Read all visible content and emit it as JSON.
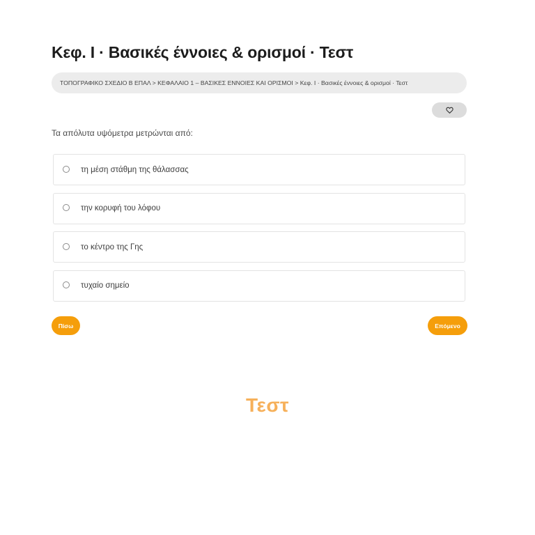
{
  "page": {
    "title": "Κεφ. Ι · Βασικές έννοιες & ορισμοί · Τεστ"
  },
  "breadcrumb": {
    "text": "ΤΟΠΟΓΡΑΦΙΚΟ ΣΧΕΔΙΟ Β ΕΠΑΛ > ΚΕΦΑΛΑΙΟ 1 – ΒΑΣΙΚΕΣ ΕΝΝΟΙΕΣ ΚΑΙ ΟΡΙΣΜΟΙ > Κεφ. Ι · Βασικές έννοιες & ορισμοί · Τεστ"
  },
  "favorite": {
    "icon": "heart-icon"
  },
  "quiz": {
    "question": "Τα απόλυτα υψόμετρα μετρώνται από:",
    "options": [
      {
        "label": "τη μέση στάθμη της θάλασσας",
        "selected": false
      },
      {
        "label": "την κορυφή του λόφου",
        "selected": false
      },
      {
        "label": "το κέντρο της Γης",
        "selected": false
      },
      {
        "label": "τυχαίο σημείο",
        "selected": false
      }
    ]
  },
  "navigation": {
    "back_label": "Πίσω",
    "next_label": "Επόμενο"
  },
  "footer": {
    "logo_text": "Τεστ"
  },
  "colors": {
    "accent": "#f59e0b",
    "logo": "#f6b05a",
    "breadcrumb_bg": "#ececec"
  }
}
